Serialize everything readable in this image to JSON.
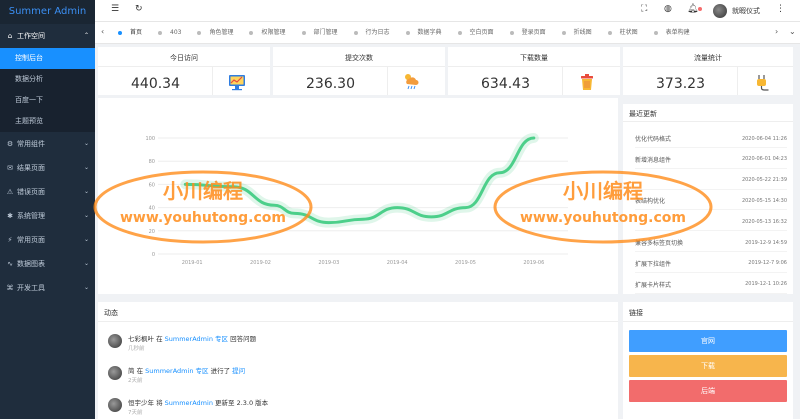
{
  "app": {
    "title": "Summer Admin"
  },
  "sidebar": {
    "groups": [
      {
        "label": "工作空间",
        "icon": "home-icon",
        "expanded": true,
        "children": [
          {
            "label": "控制后台",
            "active": true
          },
          {
            "label": "数据分析",
            "active": false
          },
          {
            "label": "百度一下",
            "active": false
          },
          {
            "label": "主题预览",
            "active": false
          }
        ]
      },
      {
        "label": "常用组件",
        "icon": "grid-icon"
      },
      {
        "label": "结果页面",
        "icon": "message-icon"
      },
      {
        "label": "错误页面",
        "icon": "warning-icon"
      },
      {
        "label": "系统管理",
        "icon": "gear-icon"
      },
      {
        "label": "常用页面",
        "icon": "bolt-icon"
      },
      {
        "label": "数据图表",
        "icon": "chart-icon"
      },
      {
        "label": "开发工具",
        "icon": "code-icon"
      }
    ]
  },
  "topbar": {
    "username": "就暇仪式"
  },
  "tabs": [
    "首页",
    "403",
    "角色管理",
    "权限管理",
    "部门管理",
    "行为日志",
    "数据字典",
    "空白页面",
    "登录页面",
    "折线图",
    "柱状图",
    "表单构建"
  ],
  "stats": [
    {
      "title": "今日访问",
      "value": "440.34",
      "icon": "chart-monitor-icon"
    },
    {
      "title": "提交次数",
      "value": "236.30",
      "icon": "cloud-rain-icon"
    },
    {
      "title": "下载数量",
      "value": "634.43",
      "icon": "trash-bin-icon"
    },
    {
      "title": "流量统计",
      "value": "373.23",
      "icon": "plug-icon"
    }
  ],
  "chart_data": {
    "type": "line",
    "x": [
      "2019-01",
      "2019-02",
      "2019-03",
      "2019-04",
      "2019-05",
      "2019-06"
    ],
    "ylim": [
      0,
      100
    ],
    "yticks": [
      0,
      20,
      40,
      60,
      80,
      100
    ],
    "points": [
      [
        0.9,
        60
      ],
      [
        1.6,
        58
      ],
      [
        2.2,
        42
      ],
      [
        2.5,
        35
      ],
      [
        3.0,
        27
      ],
      [
        3.5,
        30
      ],
      [
        4.0,
        40
      ],
      [
        4.5,
        32
      ],
      [
        5.0,
        40
      ],
      [
        5.5,
        70
      ],
      [
        6.0,
        100
      ]
    ],
    "series_color": "#4ccf8a",
    "grid": true
  },
  "recent": {
    "title": "最近更新",
    "items": [
      {
        "name": "优化代码格式",
        "date": "2020-06-04 11:26"
      },
      {
        "name": "新增消息组件",
        "date": "2020-06-01 04:23"
      },
      {
        "name": "",
        "date": "2020-05-22 21:39"
      },
      {
        "name": "表结构优化",
        "date": "2020-05-15 14:30"
      },
      {
        "name": "",
        "date": "2020-05-13 16:32"
      },
      {
        "name": "兼容多标签页切换",
        "date": "2019-12-9 14:59"
      },
      {
        "name": "扩展下拉组件",
        "date": "2019-12-7 9:06"
      },
      {
        "name": "扩展卡片样式",
        "date": "2019-12-1 10:26"
      }
    ]
  },
  "activity": {
    "title": "动态",
    "items": [
      {
        "user": "七彩枫叶",
        "mid": " 在 ",
        "link": "SummerAdmin 专区",
        "rest": " 回答问题",
        "time": "几秒前"
      },
      {
        "user": "简",
        "mid": " 在 ",
        "link": "SummerAdmin 专区",
        "rest": " 进行了 ",
        "link2": "提问",
        "time": "2天前"
      },
      {
        "user": "恒宇少年",
        "mid": " 将 ",
        "link": "SummerAdmin",
        "rest": " 更新至 2.3.0 版本",
        "time": "7天前"
      }
    ]
  },
  "links": {
    "title": "链接",
    "buttons": [
      {
        "label": "官网",
        "color": "#409eff"
      },
      {
        "label": "下载",
        "color": "#f7b54c"
      },
      {
        "label": "后端",
        "color": "#f26c6c"
      }
    ]
  },
  "watermark": {
    "line1": "小川编程",
    "line2": "www.youhutong.com",
    "color": "#ff8c1a"
  }
}
